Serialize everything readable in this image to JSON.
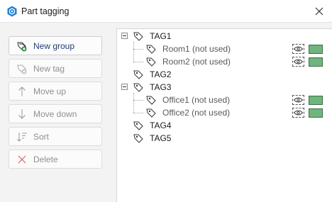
{
  "window": {
    "title": "Part tagging",
    "app_icon": "hexagon-icon",
    "close_icon": "close-icon"
  },
  "toolbar": {
    "buttons": [
      {
        "label": "New group",
        "icon": "new-group-icon",
        "enabled": true
      },
      {
        "label": "New tag",
        "icon": "new-tag-icon",
        "enabled": false
      },
      {
        "label": "Move up",
        "icon": "arrow-up-icon",
        "enabled": false
      },
      {
        "label": "Move down",
        "icon": "arrow-down-icon",
        "enabled": false
      },
      {
        "label": "Sort",
        "icon": "sort-icon",
        "enabled": false
      },
      {
        "label": "Delete",
        "icon": "delete-icon",
        "enabled": false
      }
    ]
  },
  "tree": {
    "items": [
      {
        "label": "TAG1",
        "expanded": true,
        "children": [
          {
            "label": "Room1 (not used)",
            "color": "#6fb57d"
          },
          {
            "label": "Room2 (not used)",
            "color": "#6fb57d"
          }
        ]
      },
      {
        "label": "TAG2",
        "expanded": false,
        "children": []
      },
      {
        "label": "TAG3",
        "expanded": true,
        "children": [
          {
            "label": "Office1 (not used)",
            "color": "#6fb57d"
          },
          {
            "label": "Office2 (not used)",
            "color": "#6fb57d"
          }
        ]
      },
      {
        "label": "TAG4",
        "expanded": false,
        "children": []
      },
      {
        "label": "TAG5",
        "expanded": false,
        "children": []
      }
    ]
  },
  "colors": {
    "accent": "#1f3f74",
    "swatch_green": "#6fb57d",
    "delete_red": "#e06060"
  }
}
